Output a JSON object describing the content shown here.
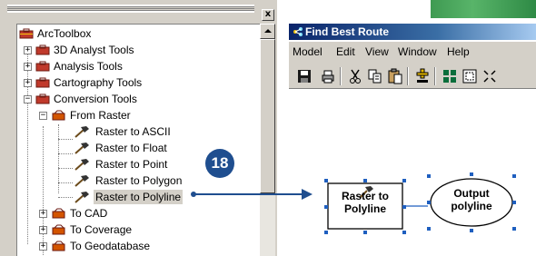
{
  "toolbox": {
    "close_glyph": "x",
    "root": {
      "label": "ArcToolbox"
    },
    "items": [
      {
        "label": "3D Analyst Tools",
        "expander": "+"
      },
      {
        "label": "Analysis Tools",
        "expander": "+"
      },
      {
        "label": "Cartography Tools",
        "expander": "+"
      },
      {
        "label": "Conversion Tools",
        "expander": "−"
      },
      {
        "label": "From Raster",
        "expander": "−"
      },
      {
        "label": "Raster to ASCII"
      },
      {
        "label": "Raster to Float"
      },
      {
        "label": "Raster to Point"
      },
      {
        "label": "Raster to Polygon"
      },
      {
        "label": "Raster to Polyline",
        "selected": true
      },
      {
        "label": "To CAD",
        "expander": "+"
      },
      {
        "label": "To Coverage",
        "expander": "+"
      },
      {
        "label": "To Geodatabase",
        "expander": "+"
      }
    ]
  },
  "callout": {
    "step": "18"
  },
  "route_window": {
    "title": "Find Best Route",
    "menu": [
      "Model",
      "Edit",
      "View",
      "Window",
      "Help"
    ],
    "toolbar": [
      "save-icon",
      "print-icon",
      "cut-icon",
      "copy-icon",
      "paste-icon",
      "add-data-icon",
      "grid-icon",
      "full-extent-icon",
      "zoom-icon"
    ]
  },
  "model": {
    "process": {
      "line1": "Raster to",
      "line2": "Polyline"
    },
    "output": {
      "line1": "Output",
      "line2": "polyline"
    }
  },
  "colors": {
    "process_fill": "#ffffff",
    "output_fill": "#ffffff",
    "selection_handle": "#1f5fbf",
    "callout": "#1f4e8f",
    "title_bar": "#0a246a"
  }
}
